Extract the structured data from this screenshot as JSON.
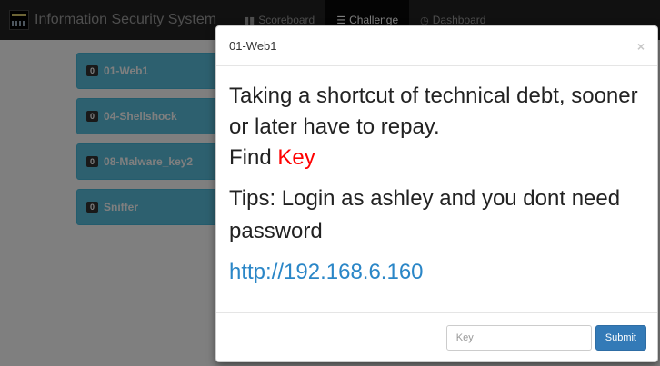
{
  "navbar": {
    "brand": "Information Security System",
    "items": [
      {
        "label": "Scoreboard",
        "icon": "bar-chart-icon",
        "glyph": "▮▮"
      },
      {
        "label": "Challenge",
        "icon": "list-icon",
        "glyph": "☰",
        "active": true
      },
      {
        "label": "Dashboard",
        "icon": "dashboard-icon",
        "glyph": "◷"
      }
    ]
  },
  "challenges": [
    {
      "badge": "0",
      "name": "01-Web1"
    },
    {
      "badge": "0",
      "name": "04-Shellshock"
    },
    {
      "badge": "0",
      "name": "08-Malware_key2"
    },
    {
      "badge": "0",
      "name": "Sniffer"
    }
  ],
  "modal": {
    "title": "01-Web1",
    "close": "×",
    "description": "Taking a shortcut of technical debt, sooner or later have to repay.",
    "find_prefix": "Find ",
    "find_key": "Key",
    "tips": "Tips: Login as ashley and you dont need password",
    "url": "http://192.168.6.160",
    "input_placeholder": "Key",
    "submit_label": "Submit"
  },
  "colors": {
    "navbar_bg": "#222222",
    "tile_bg": "#5bc0de",
    "key_red": "#ff0000",
    "link_blue": "#2a86c7",
    "submit_blue": "#337ab7"
  }
}
